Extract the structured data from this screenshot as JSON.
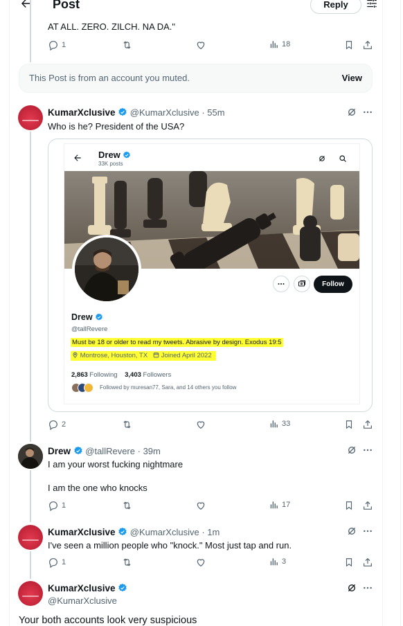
{
  "header": {
    "title": "Post",
    "reply_label": "Reply"
  },
  "top_post": {
    "text": "AT ALL. ZERO. ZILCH. NA DA.\"",
    "replies": "1",
    "views": "18"
  },
  "muted_notice": {
    "text": "This Post is from an account you muted.",
    "view_label": "View"
  },
  "post1": {
    "name": "KumarXclusive",
    "handle": "@KumarXclusive",
    "time": "· 55m",
    "text": "Who is he? President of the USA?",
    "replies": "2",
    "views": "33"
  },
  "embedded_profile": {
    "name": "Drew",
    "posts_count": "33K posts",
    "handle": "@tallRevere",
    "bio": "Must be 18 or older to read my tweets. Abrasive by design. Exodus 19:5",
    "location": "Montrose, Houston, TX",
    "joined": "Joined April 2022",
    "following_count": "2,863",
    "following_label": "Following",
    "followers_count": "3,403",
    "followers_label": "Followers",
    "followed_by": "Followed by muresan77, Sara, and 14 others you follow",
    "follow_label": "Follow"
  },
  "post2": {
    "name": "Drew",
    "handle": "@tallRevere",
    "time": "· 39m",
    "line1": "I am your worst fucking nightmare",
    "line2": "I am the one who knocks",
    "replies": "1",
    "views": "17"
  },
  "post3": {
    "name": "KumarXclusive",
    "handle": "@KumarXclusive",
    "time": "· 1m",
    "text": "I've seen a million people who \"knock.\" Most just tap and run.",
    "replies": "1",
    "views": "3"
  },
  "post4": {
    "name": "KumarXclusive",
    "handle": "@KumarXclusive",
    "text": "Your both accounts look very suspicious"
  },
  "colors": {
    "verified": "#1d9bf0",
    "muted_text": "#536471",
    "highlight": "#ffff33"
  }
}
